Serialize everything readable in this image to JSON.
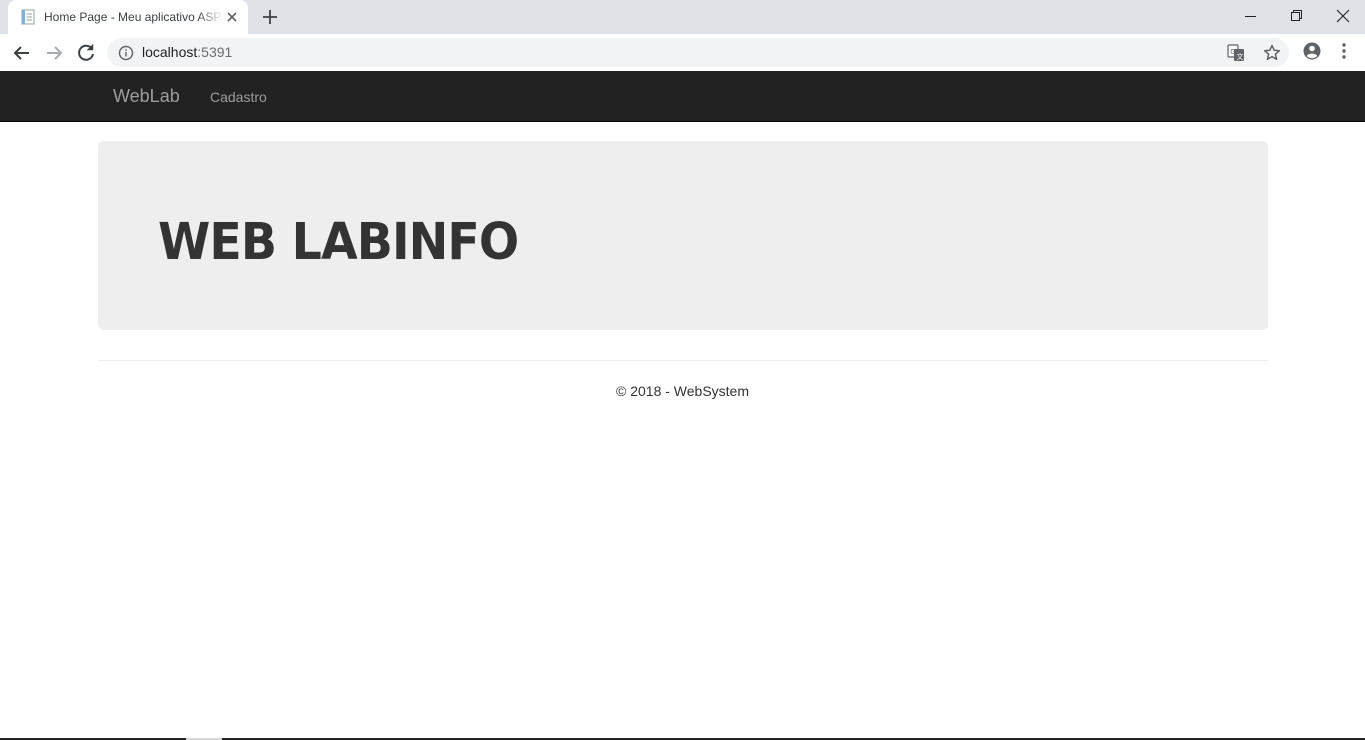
{
  "browser": {
    "tab": {
      "title": "Home Page - Meu aplicativo ASP.NET",
      "favicon": "document-icon"
    },
    "new_tab_icon": "plus-icon",
    "window_controls": [
      "minimize-icon",
      "restore-icon",
      "close-icon"
    ],
    "address": {
      "host": "localhost",
      "port": ":5391",
      "security_icon": "info-icon"
    },
    "toolbar_icons": [
      "translate-icon",
      "star-icon",
      "profile-icon",
      "menu-icon"
    ],
    "nav_icons": [
      "back-icon",
      "forward-icon",
      "reload-icon"
    ]
  },
  "navbar": {
    "brand": "WebLab",
    "links": [
      {
        "label": "Cadastro"
      }
    ]
  },
  "jumbotron": {
    "title": "WEB LABINFO"
  },
  "footer": {
    "text": "© 2018 - WebSystem"
  },
  "colors": {
    "navbar_bg": "#222222",
    "navbar_text": "#9d9d9d",
    "jumbotron_bg": "#eeeeee",
    "title_text": "#333333"
  }
}
